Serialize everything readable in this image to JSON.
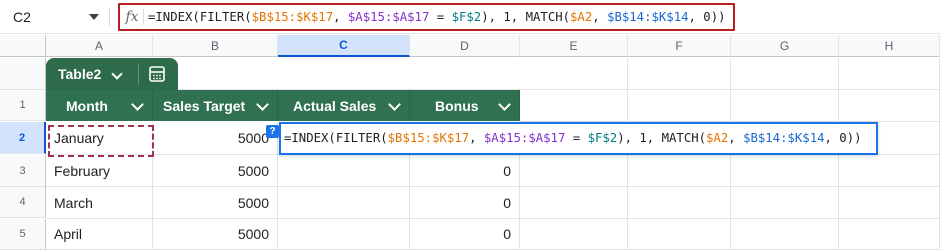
{
  "formula_bar": {
    "name_box": "C2",
    "fx_label": "fx",
    "tokens": [
      {
        "text": "=INDEX(FILTER(",
        "color": "#202124"
      },
      {
        "text": "$B$15:$K$17",
        "color": "#e37400"
      },
      {
        "text": ", ",
        "color": "#202124"
      },
      {
        "text": "$A$15:$A$17",
        "color": "#8430ce"
      },
      {
        "text": " = ",
        "color": "#202124"
      },
      {
        "text": "$F$2",
        "color": "#007b83"
      },
      {
        "text": "), 1, MATCH(",
        "color": "#202124"
      },
      {
        "text": "$A2",
        "color": "#e37400"
      },
      {
        "text": ", ",
        "color": "#202124"
      },
      {
        "text": "$B$14:$K$14",
        "color": "#1967d2"
      },
      {
        "text": ", 0))",
        "color": "#202124"
      }
    ]
  },
  "columns": [
    "A",
    "B",
    "C",
    "D",
    "E",
    "F",
    "G",
    "H"
  ],
  "rows": [
    "1",
    "2",
    "3",
    "4",
    "5"
  ],
  "table": {
    "name": "Table2",
    "headers": [
      "Month",
      "Sales Target",
      "Actual Sales",
      "Bonus"
    ],
    "body": [
      {
        "month": "January",
        "target": "5000",
        "actual": "",
        "bonus": ""
      },
      {
        "month": "February",
        "target": "5000",
        "actual": "",
        "bonus": "0"
      },
      {
        "month": "March",
        "target": "5000",
        "actual": "",
        "bonus": "0"
      },
      {
        "month": "April",
        "target": "5000",
        "actual": "",
        "bonus": "0"
      }
    ]
  },
  "editor": {
    "help_badge": "?",
    "brand_colors": {
      "table_header": "#2f7151",
      "selection": "#1a73e8",
      "highlight_frame": "#b91d1d"
    }
  }
}
